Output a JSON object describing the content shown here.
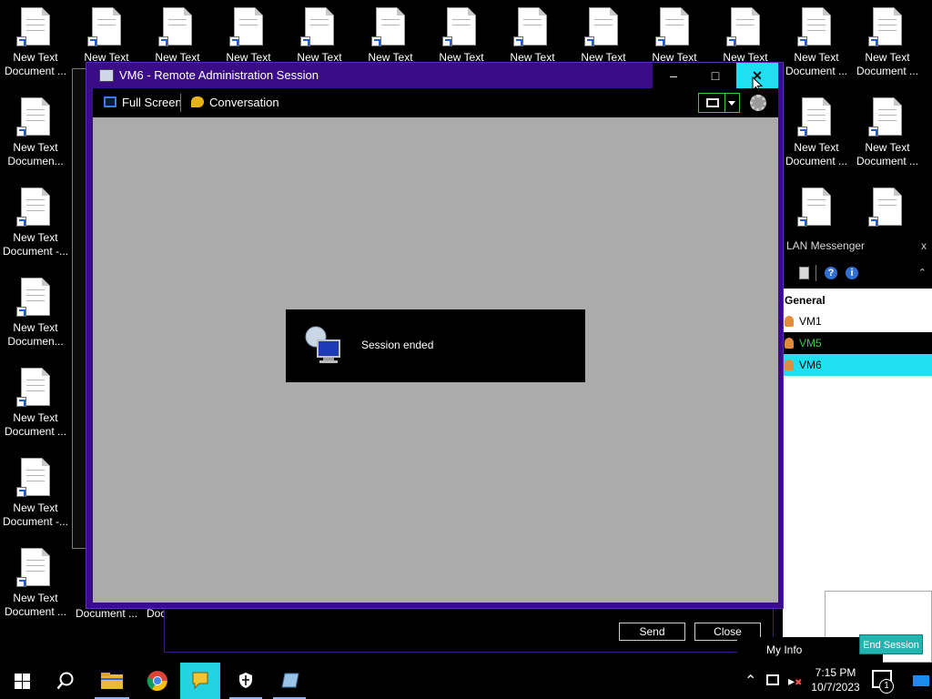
{
  "desktop": {
    "icon_label_line1": "New Text",
    "icon_labels": {
      "document_ellipsis": "Document ...",
      "documen_ellipsis": "Documen...",
      "document_dash": "Document -..."
    },
    "peeking_labels": [
      "Docu",
      "Doc"
    ]
  },
  "remote_window": {
    "title": "VM6 - Remote Administration Session",
    "minimize_label": "–",
    "maximize_label": "□",
    "close_label": "✕",
    "toolbar": {
      "fullscreen_label": "Full Screen",
      "conversation_label": "Conversation"
    },
    "status_message": "Session ended"
  },
  "chat_window": {
    "send_label": "Send",
    "close_label": "Close"
  },
  "lan_messenger": {
    "title": "LAN Messenger",
    "close_label": "x",
    "group_name": "General",
    "users": [
      {
        "name": "VM1",
        "state": "normal"
      },
      {
        "name": "VM5",
        "state": "highlight-dark"
      },
      {
        "name": "VM6",
        "state": "selected"
      }
    ],
    "my_info_label": "My Info",
    "end_session_label": "End Session"
  },
  "taskbar": {
    "time": "7:15 PM",
    "date": "10/7/2023",
    "notification_count": "1"
  },
  "colors": {
    "window_border": "#3a0d86",
    "close_hover": "#1ee0f0",
    "selected_row": "#1ee0f0",
    "highlight_green": "#3cc84a",
    "content_gray": "#ababab"
  }
}
